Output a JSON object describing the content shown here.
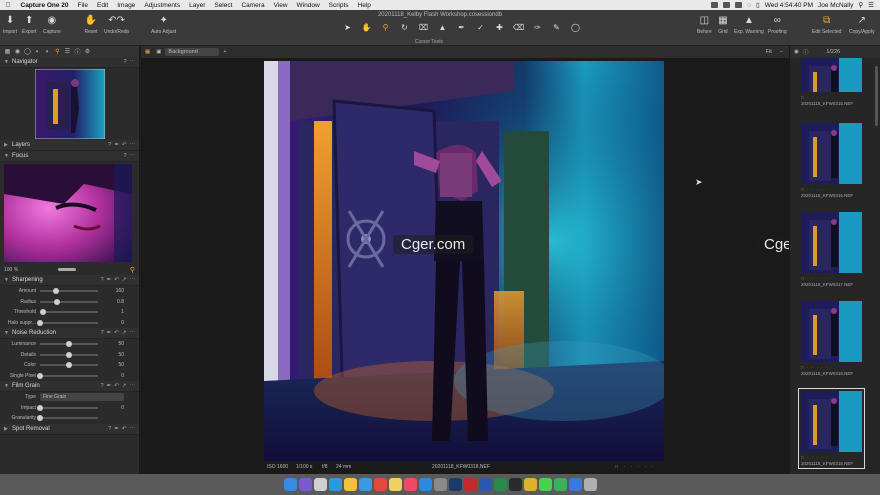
{
  "menubar": {
    "apple": "",
    "items": [
      "Capture One 20",
      "File",
      "Edit",
      "Image",
      "Adjustments",
      "Layer",
      "Select",
      "Camera",
      "View",
      "Window",
      "Scripts",
      "Help"
    ],
    "clock": "Wed 4:54:40 PM",
    "user": "Joe McNally"
  },
  "toolbar": {
    "doc_title": "20201118_Kelby Flash Workshop.cosessiondb",
    "left_buttons": [
      "Import",
      "Export",
      "Capture",
      "Reset",
      "Undo/Redo",
      "Auto Adjust"
    ],
    "cursor_tools_label": "Cursor Tools",
    "right_buttons": [
      "Before",
      "Grid",
      "Exp. Warning",
      "Proofing",
      "Edit Selected",
      "Copy/Apply"
    ]
  },
  "left_panel": {
    "navigator_title": "Navigator",
    "layers_title": "Layers",
    "focus_title": "Focus",
    "focus_zoom": "100 %",
    "sharpening": {
      "title": "Sharpening",
      "rows": [
        {
          "label": "Amount",
          "value": "160",
          "level": 0.27
        },
        {
          "label": "Radius",
          "value": "0.8",
          "level": 0.3
        },
        {
          "label": "Threshold",
          "value": "1",
          "level": 0.05
        },
        {
          "label": "Halo suppr...",
          "value": "0",
          "level": 0.0
        }
      ]
    },
    "noise_reduction": {
      "title": "Noise Reduction",
      "rows": [
        {
          "label": "Luminance",
          "value": "50",
          "level": 0.5
        },
        {
          "label": "Details",
          "value": "50",
          "level": 0.5
        },
        {
          "label": "Color",
          "value": "50",
          "level": 0.5
        },
        {
          "label": "Single Pixel",
          "value": "0",
          "level": 0.0
        }
      ]
    },
    "film_grain": {
      "title": "Film Grain",
      "type_label": "Type",
      "type_value": "Fine Grain",
      "rows": [
        {
          "label": "Impact",
          "value": "0",
          "level": 0.0
        },
        {
          "label": "Granularity",
          "value": "",
          "level": 0.0
        }
      ]
    },
    "spot_removal_title": "Spot Removal"
  },
  "viewer": {
    "layer_select": "Background",
    "fit_label": "Fit",
    "counter": "1/226",
    "watermark": "Cger.com",
    "caption": {
      "iso": "ISO 1600",
      "shutter": "1/100 s",
      "aperture": "f/8",
      "focal": "24 mm",
      "filename": "20201118_KFW0318.NEF"
    }
  },
  "browser": {
    "thumbnails": [
      {
        "filename": "20201118_KFW0315.NEF",
        "selected": false
      },
      {
        "filename": "20201118_KFW0316.NEF",
        "selected": false
      },
      {
        "filename": "20201118_KFW0317.NEF",
        "selected": false
      },
      {
        "filename": "20201118_KFW0318.NEF",
        "selected": false
      },
      {
        "filename": "20201118_KFW0318.NEF",
        "selected": true
      }
    ]
  },
  "colors": {
    "accent": "#f0a23a",
    "panel": "#2b2b2b",
    "toolbar": "#3a3a3a"
  },
  "dock_icons": [
    "finder-icon",
    "siri-icon",
    "launchpad-icon",
    "safari-icon",
    "photos-icon",
    "mail-icon",
    "calendar-icon",
    "notes-icon",
    "music-icon",
    "appstore-icon",
    "settings-icon",
    "photoshop-icon",
    "acrobat-icon",
    "word-icon",
    "excel-icon",
    "capture-one-icon",
    "chrome-icon",
    "messages-icon",
    "facetime-icon",
    "keynote-icon",
    "trash-icon"
  ]
}
